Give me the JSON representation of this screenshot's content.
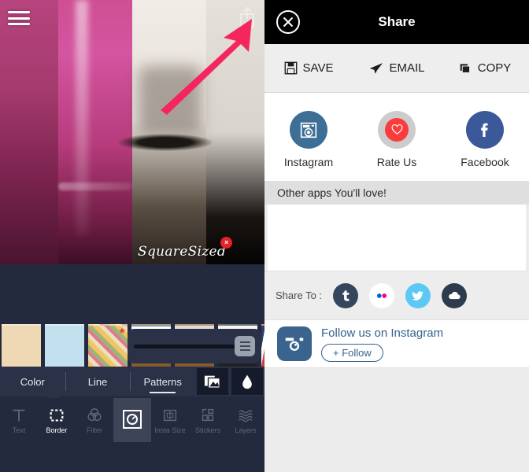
{
  "editor": {
    "menu_icon": "hamburger-menu-icon",
    "share_icon": "share-export-icon",
    "arrow_annotation": "red-arrow-pointer",
    "watermark": {
      "text": "SquareSized",
      "close_label": "×"
    },
    "subtabs": [
      {
        "label": "Color",
        "selected": false
      },
      {
        "label": "Line",
        "selected": false
      },
      {
        "label": "Patterns",
        "selected": true
      }
    ],
    "subtab_buttons": [
      {
        "name": "gallery-icon"
      },
      {
        "name": "droplet-icon"
      }
    ],
    "swatches": [
      "beige-texture",
      "light-blue",
      "diagonal-stripes-star",
      "color-stripes",
      "wood-paper",
      "black-white",
      "navy-stripes"
    ],
    "slider": {
      "name": "pattern-opacity-slider"
    },
    "tools": [
      {
        "label": "Text",
        "icon": "text-icon",
        "state": "inactive"
      },
      {
        "label": "Border",
        "icon": "border-icon",
        "state": "active"
      },
      {
        "label": "Filter",
        "icon": "filter-icon",
        "state": "inactive"
      },
      {
        "label": "",
        "icon": "lens-icon",
        "state": "selected"
      },
      {
        "label": "Insta Size",
        "icon": "insta-size-icon",
        "state": "inactive"
      },
      {
        "label": "Stickers",
        "icon": "stickers-icon",
        "state": "inactive"
      },
      {
        "label": "Layers",
        "icon": "layers-icon",
        "state": "inactive"
      }
    ]
  },
  "share": {
    "title": "Share",
    "close_icon": "close-circle-icon",
    "actions": [
      {
        "label": "SAVE",
        "icon": "floppy-disk-icon"
      },
      {
        "label": "EMAIL",
        "icon": "paper-plane-icon"
      },
      {
        "label": "COPY",
        "icon": "copy-stack-icon"
      }
    ],
    "socials": [
      {
        "label": "Instagram",
        "icon": "instagram-camera-icon",
        "color": "#3c6e96"
      },
      {
        "label": "Rate Us",
        "icon": "heart-icon",
        "color": "#cccccc",
        "inner_color": "#fa3c3c"
      },
      {
        "label": "Facebook",
        "icon": "facebook-f-icon",
        "color": "#3b5998"
      }
    ],
    "other_apps_label": "Other apps You'll love!",
    "share_to_label": "Share To :",
    "share_to_items": [
      {
        "name": "tumblr-icon",
        "color": "#35465c"
      },
      {
        "name": "flickr-icon",
        "color": "#ffffff"
      },
      {
        "name": "twitter-icon",
        "color": "#5ec8f5"
      },
      {
        "name": "cloud-icon",
        "color": "#2d3b4e"
      }
    ],
    "follow": {
      "text": "Follow us on Instagram",
      "button_label": "+ Follow",
      "icon": "instagram-rounded-icon"
    }
  }
}
